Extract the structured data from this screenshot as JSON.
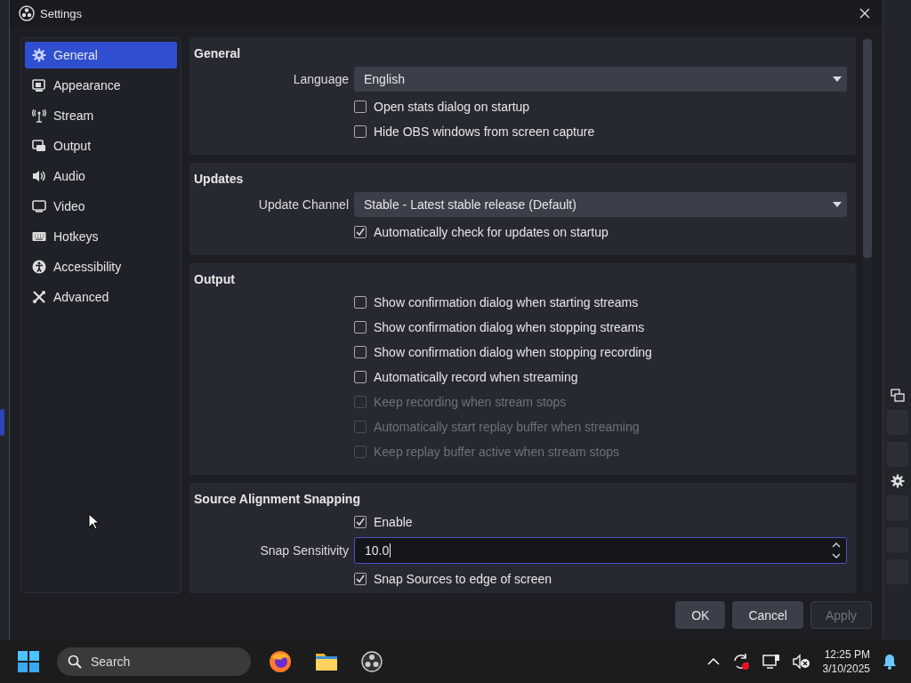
{
  "window": {
    "title": "Settings"
  },
  "sidebar": {
    "items": [
      {
        "label": "General",
        "selected": true
      },
      {
        "label": "Appearance",
        "selected": false
      },
      {
        "label": "Stream",
        "selected": false
      },
      {
        "label": "Output",
        "selected": false
      },
      {
        "label": "Audio",
        "selected": false
      },
      {
        "label": "Video",
        "selected": false
      },
      {
        "label": "Hotkeys",
        "selected": false
      },
      {
        "label": "Accessibility",
        "selected": false
      },
      {
        "label": "Advanced",
        "selected": false
      }
    ]
  },
  "sections": [
    {
      "title": "General",
      "rows": [
        {
          "kind": "select",
          "label": "Language",
          "value": "English"
        },
        {
          "kind": "checkbox",
          "label": "Open stats dialog on startup",
          "checked": false,
          "disabled": false
        },
        {
          "kind": "checkbox",
          "label": "Hide OBS windows from screen capture",
          "checked": false,
          "disabled": false
        }
      ]
    },
    {
      "title": "Updates",
      "rows": [
        {
          "kind": "select",
          "label": "Update Channel",
          "value": "Stable - Latest stable release (Default)"
        },
        {
          "kind": "checkbox",
          "label": "Automatically check for updates on startup",
          "checked": true,
          "disabled": false
        }
      ]
    },
    {
      "title": "Output",
      "rows": [
        {
          "kind": "checkbox",
          "label": "Show confirmation dialog when starting streams",
          "checked": false,
          "disabled": false
        },
        {
          "kind": "checkbox",
          "label": "Show confirmation dialog when stopping streams",
          "checked": false,
          "disabled": false
        },
        {
          "kind": "checkbox",
          "label": "Show confirmation dialog when stopping recording",
          "checked": false,
          "disabled": false
        },
        {
          "kind": "checkbox",
          "label": "Automatically record when streaming",
          "checked": false,
          "disabled": false
        },
        {
          "kind": "checkbox",
          "label": "Keep recording when stream stops",
          "checked": false,
          "disabled": true
        },
        {
          "kind": "checkbox",
          "label": "Automatically start replay buffer when streaming",
          "checked": false,
          "disabled": true
        },
        {
          "kind": "checkbox",
          "label": "Keep replay buffer active when stream stops",
          "checked": false,
          "disabled": true
        }
      ]
    },
    {
      "title": "Source Alignment Snapping",
      "rows": [
        {
          "kind": "checkbox",
          "label": "Enable",
          "checked": true,
          "disabled": false
        },
        {
          "kind": "spin",
          "label": "Snap Sensitivity",
          "value": "10.0"
        },
        {
          "kind": "checkbox",
          "label": "Snap Sources to edge of screen",
          "checked": true,
          "disabled": false
        }
      ]
    }
  ],
  "buttons": [
    {
      "label": "OK",
      "disabled": false
    },
    {
      "label": "Cancel",
      "disabled": false
    },
    {
      "label": "Apply",
      "disabled": true
    }
  ],
  "taskbar": {
    "search_placeholder": "Search",
    "time": "12:25 PM",
    "date": "3/10/2025"
  }
}
